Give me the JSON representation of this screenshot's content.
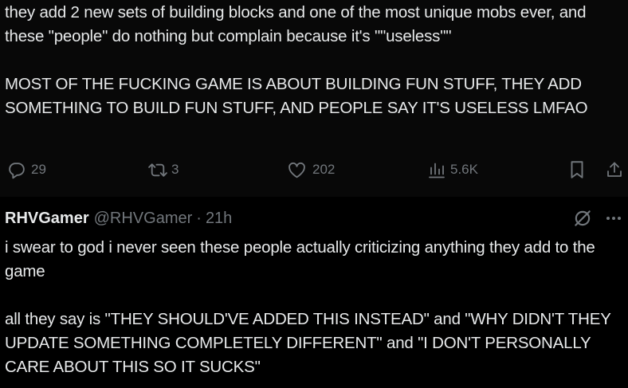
{
  "post": {
    "text": "they add 2 new sets of building blocks and one of the most unique mobs ever, and these \"people\" do nothing but complain because it's \"\"useless\"\"\n\nMOST OF THE FUCKING GAME IS ABOUT BUILDING FUN STUFF, THEY ADD SOMETHING TO BUILD FUN STUFF, AND PEOPLE SAY IT'S USELESS LMFAO",
    "replies": "29",
    "reposts": "3",
    "likes": "202",
    "views": "5.6K"
  },
  "reply": {
    "name": "RHVGamer",
    "handle": "@RHVGamer",
    "separator": "·",
    "time": "21h",
    "text": "i swear to god i never seen these people actually criticizing anything they add to the game\n\nall they say is \"THEY SHOULD'VE ADDED THIS INSTEAD\" and \"WHY DIDN'T THEY UPDATE SOMETHING COMPLETELY DIFFERENT\" and \"I DON'T PERSONALLY CARE ABOUT THIS SO IT SUCKS\""
  },
  "icons": {
    "reply": "reply-icon",
    "repost": "repost-icon",
    "like": "heart-icon",
    "views": "views-icon",
    "bookmark": "bookmark-icon",
    "share": "share-icon",
    "grok": "grok-icon",
    "more": "more-icon"
  },
  "colors": {
    "background": "#000000",
    "text": "#e7e9ea",
    "muted": "#71767b"
  }
}
